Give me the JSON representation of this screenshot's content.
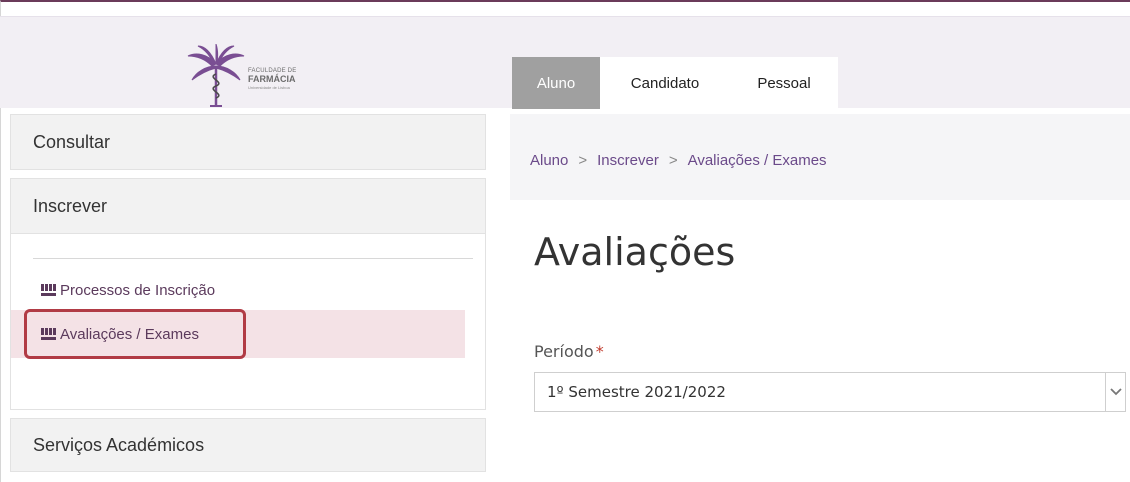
{
  "logo": {
    "line1": "FACULDADE DE",
    "line2": "FARMÁCIA",
    "line3": "Universidade de Lisboa"
  },
  "tabs": [
    {
      "label": "Aluno",
      "active": true
    },
    {
      "label": "Candidato",
      "active": false
    },
    {
      "label": "Pessoal",
      "active": false
    }
  ],
  "sidebar": {
    "sections": {
      "consultar": "Consultar",
      "inscrever": "Inscrever",
      "servicos": "Serviços Académicos"
    },
    "items": [
      {
        "label": "Processos de Inscrição",
        "icon": "grid-icon"
      },
      {
        "label": "Avaliações / Exames",
        "icon": "grid-icon",
        "active": true
      }
    ]
  },
  "breadcrumb": [
    "Aluno",
    ">",
    "Inscrever",
    ">",
    "Avaliações / Exames"
  ],
  "page_title": "Avaliações",
  "periodo": {
    "label": "Período",
    "required_mark": "*",
    "value": "1º Semestre 2021/2022"
  },
  "colors": {
    "accent": "#6b4a8a",
    "active_tab": "#a0a0a0",
    "active_item_bg": "#f4e2e6",
    "highlight": "#b13b45"
  }
}
